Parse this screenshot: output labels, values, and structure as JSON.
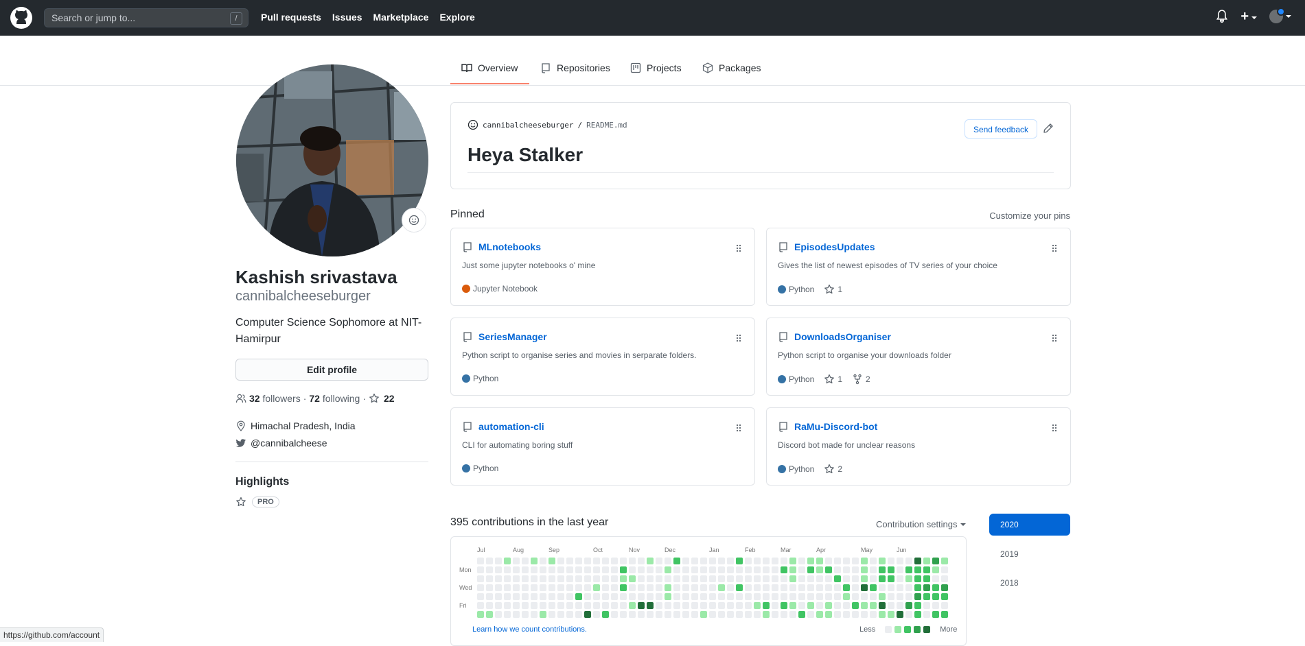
{
  "header": {
    "search_placeholder": "Search or jump to...",
    "search_shortcut": "/",
    "nav": [
      "Pull requests",
      "Issues",
      "Marketplace",
      "Explore"
    ]
  },
  "tabs": [
    {
      "label": "Overview",
      "icon": "book-icon",
      "selected": true
    },
    {
      "label": "Repositories",
      "icon": "repo-icon"
    },
    {
      "label": "Projects",
      "icon": "project-icon"
    },
    {
      "label": "Packages",
      "icon": "package-icon"
    }
  ],
  "profile": {
    "full_name": "Kashish srivastava",
    "username": "cannibalcheeseburger",
    "bio": "Computer Science Sophomore at NIT-Hamirpur",
    "edit_label": "Edit profile",
    "followers_count": "32",
    "followers_label": "followers",
    "following_count": "72",
    "following_label": "following",
    "stars_count": "22",
    "location": "Himachal Pradesh, India",
    "twitter": "@cannibalcheese",
    "highlights_title": "Highlights",
    "pro_label": "PRO"
  },
  "readme": {
    "owner": "cannibalcheeseburger",
    "sep": "/",
    "file": "README.md",
    "feedback_label": "Send feedback",
    "heading": "Heya Stalker"
  },
  "pinned": {
    "title": "Pinned",
    "customize_label": "Customize your pins",
    "repos": [
      {
        "name": "MLnotebooks",
        "desc": "Just some jupyter notebooks o' mine",
        "lang": "Jupyter Notebook",
        "lang_color": "#DA5B0B",
        "stars": "",
        "forks": ""
      },
      {
        "name": "EpisodesUpdates",
        "desc": "Gives the list of newest episodes of TV series of your choice",
        "lang": "Python",
        "lang_color": "#3572A5",
        "stars": "1",
        "forks": ""
      },
      {
        "name": "SeriesManager",
        "desc": "Python script to organise series and movies in serparate folders.",
        "lang": "Python",
        "lang_color": "#3572A5",
        "stars": "",
        "forks": ""
      },
      {
        "name": "DownloadsOrganiser",
        "desc": "Python script to organise your downloads folder",
        "lang": "Python",
        "lang_color": "#3572A5",
        "stars": "1",
        "forks": "2"
      },
      {
        "name": "automation-cli",
        "desc": "CLI for automating boring stuff",
        "lang": "Python",
        "lang_color": "#3572A5",
        "stars": "",
        "forks": ""
      },
      {
        "name": "RaMu-Discord-bot",
        "desc": "Discord bot made for unclear reasons",
        "lang": "Python",
        "lang_color": "#3572A5",
        "stars": "2",
        "forks": ""
      }
    ]
  },
  "contributions": {
    "summary": "395 contributions in the last year",
    "settings_label": "Contribution settings",
    "months": [
      "Jul",
      "Aug",
      "Sep",
      "Oct",
      "Nov",
      "Dec",
      "Jan",
      "Feb",
      "Mar",
      "Apr",
      "May",
      "Jun"
    ],
    "days": [
      "Mon",
      "Wed",
      "Fri"
    ],
    "learn_label": "Learn how we count contributions.",
    "less_label": "Less",
    "more_label": "More",
    "colors": [
      "#ebedf0",
      "#9be9a8",
      "#40c463",
      "#30a14e",
      "#216e39"
    ],
    "years": [
      "2020",
      "2019",
      "2018"
    ],
    "active_year": "2020"
  },
  "status_url": "https://github.com/account"
}
